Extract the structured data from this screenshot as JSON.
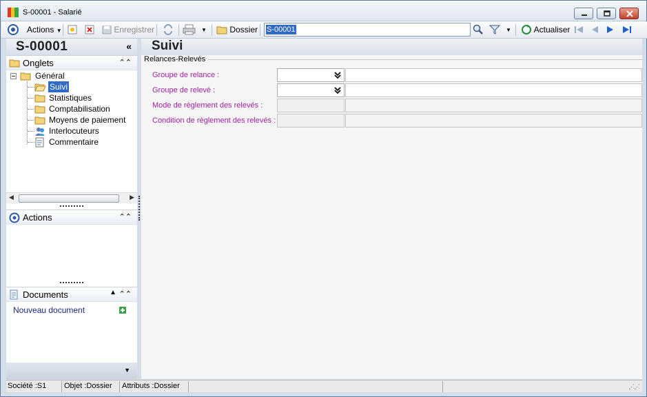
{
  "window": {
    "title": "S-00001 -  Salarié",
    "controls": [
      "minimize",
      "maximize",
      "close"
    ]
  },
  "toolbar": {
    "actions_label": "Actions",
    "save_label": "Enregistrer",
    "dossier_label": "Dossier",
    "search_value": "S-00001",
    "refresh_label": "Actualiser"
  },
  "left": {
    "record_code": "S-00001",
    "tabs_section": "Onglets",
    "tree": {
      "root": "Général",
      "items": [
        "Suivi",
        "Statistiques",
        "Comptabilisation",
        "Moyens de paiement",
        "Interlocuteurs",
        "Commentaire"
      ],
      "selected": "Suivi"
    },
    "actions_section": "Actions",
    "documents_section": "Documents",
    "new_document_link": "Nouveau document"
  },
  "main": {
    "title": "Suivi",
    "group_title": "Relances-Relevés",
    "fields": [
      {
        "label": "Groupe de relance :",
        "value": "",
        "type": "dropdown"
      },
      {
        "label": "Groupe de relevé :",
        "value": "",
        "type": "dropdown"
      },
      {
        "label": "Mode de règlement des relevés :",
        "value": "",
        "type": "readonly"
      },
      {
        "label": "Condition de règlement des relevés :",
        "value": "",
        "type": "readonly"
      }
    ]
  },
  "status": {
    "societe": "Société :S1",
    "objet": "Objet :Dossier",
    "attributs": "Attributs :Dossier"
  },
  "colors": {
    "field_label": "#a020a0",
    "selection": "#316ac5",
    "link": "#1a2a7a"
  }
}
